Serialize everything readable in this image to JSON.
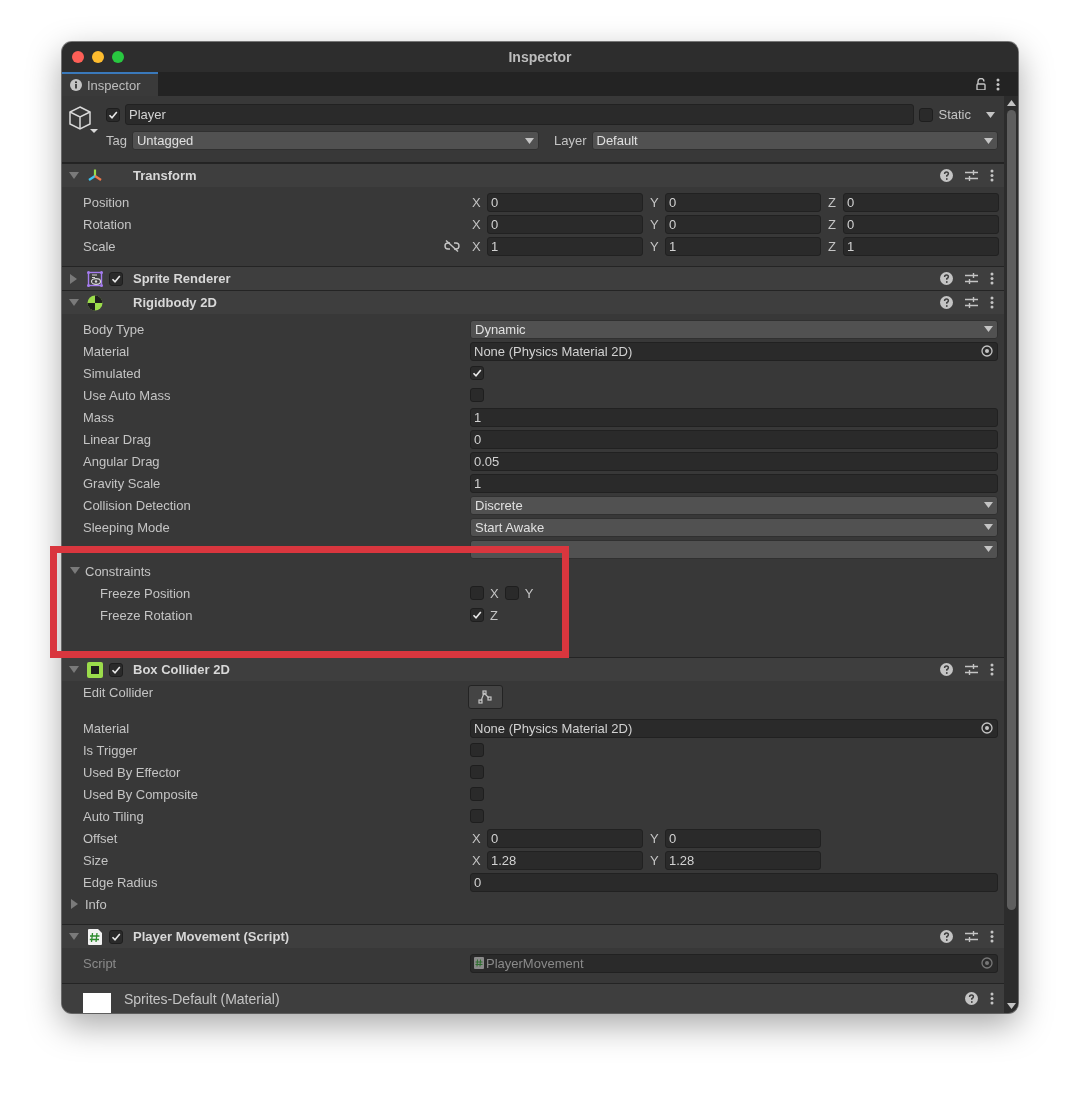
{
  "window": {
    "title": "Inspector"
  },
  "tab": {
    "label": "Inspector",
    "selected": true
  },
  "object": {
    "active": true,
    "name": "Player",
    "static": false,
    "static_label": "Static",
    "tag_label": "Tag",
    "tag": "Untagged",
    "layer_label": "Layer",
    "layer": "Default"
  },
  "components": [
    {
      "kind": "transform",
      "title": "Transform",
      "expanded": true,
      "fields": [
        {
          "kind": "vector",
          "label": "Position",
          "axes": [
            {
              "axis": "X",
              "value": "0"
            },
            {
              "axis": "Y",
              "value": "0"
            },
            {
              "axis": "Z",
              "value": "0"
            }
          ]
        },
        {
          "kind": "vector",
          "label": "Rotation",
          "axes": [
            {
              "axis": "X",
              "value": "0"
            },
            {
              "axis": "Y",
              "value": "0"
            },
            {
              "axis": "Z",
              "value": "0"
            }
          ]
        },
        {
          "kind": "vector",
          "label": "Scale",
          "proportions_linked": false,
          "axes": [
            {
              "axis": "X",
              "value": "1"
            },
            {
              "axis": "Y",
              "value": "1"
            },
            {
              "axis": "Z",
              "value": "1"
            }
          ]
        }
      ]
    },
    {
      "kind": "sprite",
      "title": "Sprite Renderer",
      "expanded": false,
      "enabled": true
    },
    {
      "kind": "rigidbody",
      "title": "Rigidbody 2D",
      "expanded": true,
      "fields": [
        {
          "kind": "dropdown",
          "label": "Body Type",
          "value": "Dynamic"
        },
        {
          "kind": "object",
          "label": "Material",
          "value": "None (Physics Material 2D)"
        },
        {
          "kind": "checkbox",
          "label": "Simulated",
          "checked": true
        },
        {
          "kind": "checkbox",
          "label": "Use Auto Mass",
          "checked": false
        },
        {
          "kind": "number",
          "label": "Mass",
          "value": "1"
        },
        {
          "kind": "number",
          "label": "Linear Drag",
          "value": "0"
        },
        {
          "kind": "number",
          "label": "Angular Drag",
          "value": "0.05"
        },
        {
          "kind": "number",
          "label": "Gravity Scale",
          "value": "1"
        },
        {
          "kind": "dropdown",
          "label": "Collision Detection",
          "value": "Discrete"
        },
        {
          "kind": "dropdown",
          "label": "Sleeping Mode",
          "value": "Start Awake"
        },
        {
          "kind": "covered_dropdown"
        },
        {
          "kind": "foldout",
          "label": "Constraints",
          "expanded": true,
          "children": [
            {
              "kind": "flags",
              "label": "Freeze Position",
              "flags": [
                {
                  "axis": "X",
                  "checked": false
                },
                {
                  "axis": "Y",
                  "checked": false
                }
              ]
            },
            {
              "kind": "flags",
              "label": "Freeze Rotation",
              "flags": [
                {
                  "axis": "Z",
                  "checked": true
                }
              ]
            }
          ]
        },
        {
          "kind": "covered_row"
        }
      ]
    },
    {
      "kind": "box",
      "title": "Box Collider 2D",
      "expanded": true,
      "enabled": true,
      "fields": [
        {
          "kind": "edit_button",
          "label": "Edit Collider"
        },
        {
          "kind": "object",
          "label": "Material",
          "value": "None (Physics Material 2D)"
        },
        {
          "kind": "checkbox",
          "label": "Is Trigger",
          "checked": false
        },
        {
          "kind": "checkbox",
          "label": "Used By Effector",
          "checked": false
        },
        {
          "kind": "checkbox",
          "label": "Used By Composite",
          "checked": false
        },
        {
          "kind": "checkbox",
          "label": "Auto Tiling",
          "checked": false
        },
        {
          "kind": "vector",
          "label": "Offset",
          "axes": [
            {
              "axis": "X",
              "value": "0"
            },
            {
              "axis": "Y",
              "value": "0"
            }
          ]
        },
        {
          "kind": "vector",
          "label": "Size",
          "axes": [
            {
              "axis": "X",
              "value": "1.28"
            },
            {
              "axis": "Y",
              "value": "1.28"
            }
          ]
        },
        {
          "kind": "number",
          "label": "Edge Radius",
          "value": "0"
        },
        {
          "kind": "foldout",
          "label": "Info",
          "expanded": false
        }
      ]
    },
    {
      "kind": "script",
      "title": "Player Movement (Script)",
      "expanded": true,
      "enabled": true,
      "fields": [
        {
          "kind": "script",
          "label": "Script",
          "value": "PlayerMovement",
          "disabled": true
        }
      ]
    }
  ],
  "material": {
    "name": "Sprites-Default (Material)"
  },
  "annotation": {
    "kind": "highlight"
  }
}
